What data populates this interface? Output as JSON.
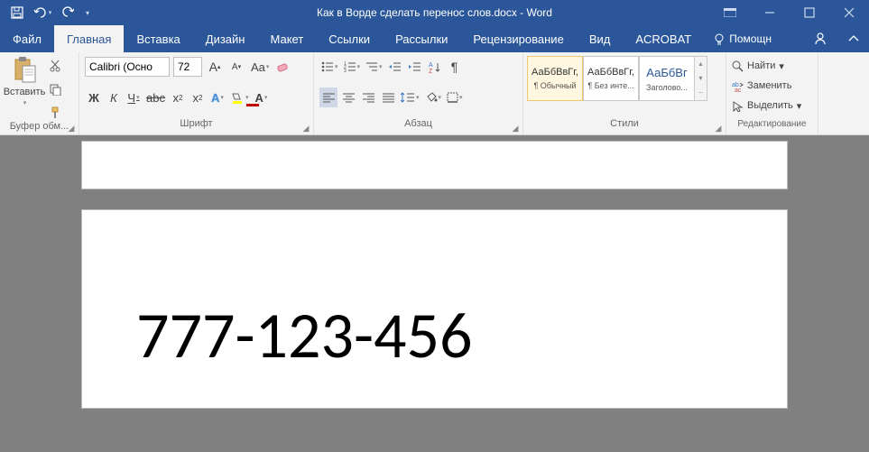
{
  "title": "Как в Ворде сделать перенос слов.docx - Word",
  "tabs": {
    "file": "Файл",
    "home": "Главная",
    "insert": "Вставка",
    "design": "Дизайн",
    "layout": "Макет",
    "references": "Ссылки",
    "mailings": "Рассылки",
    "review": "Рецензирование",
    "view": "Вид",
    "acrobat": "ACROBAT",
    "help": "Помощн"
  },
  "clipboard": {
    "paste": "Вставить",
    "label": "Буфер обм..."
  },
  "font": {
    "name": "Calibri (Осно",
    "size": "72",
    "label": "Шрифт",
    "bold": "Ж",
    "italic": "К",
    "underline": "Ч",
    "strike": "abc",
    "sub": "x₂",
    "sup": "x²",
    "case": "Aa",
    "grow": "A",
    "shrink": "A"
  },
  "paragraph": {
    "label": "Абзац"
  },
  "styles": {
    "label": "Стили",
    "preview": "АаБбВвГг,",
    "preview2": "АаБбВвГг,",
    "preview3": "АаБбВг",
    "normal": "¶ Обычный",
    "nospacing": "¶ Без инте...",
    "heading1": "Заголово..."
  },
  "editing": {
    "label": "Редактирование",
    "find": "Найти",
    "replace": "Заменить",
    "select": "Выделить"
  },
  "document": {
    "text": "777-123-456"
  }
}
